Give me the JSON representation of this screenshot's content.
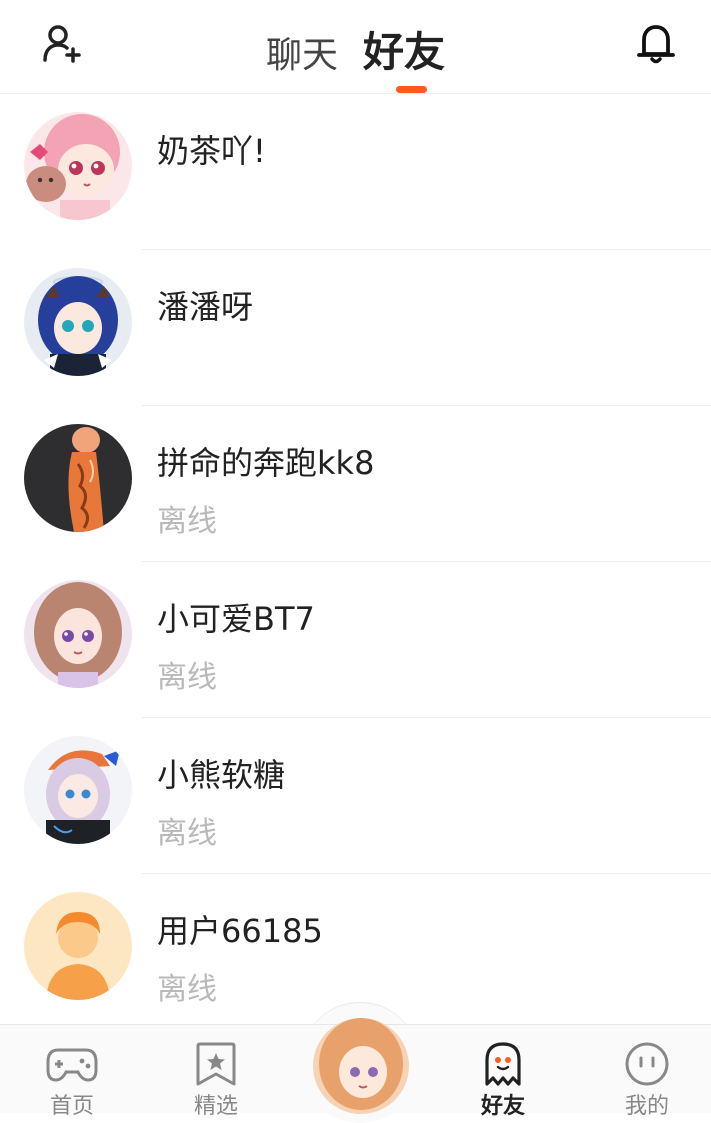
{
  "header": {
    "tabs": [
      {
        "label": "聊天",
        "active": false
      },
      {
        "label": "好友",
        "active": true
      }
    ],
    "accent_color": "#ff5a1f"
  },
  "friends": [
    {
      "name": "奶茶吖!",
      "status": "",
      "avatar": "pink-hair-anime-avatar"
    },
    {
      "name": "潘潘呀",
      "status": "",
      "avatar": "blue-hair-anime-avatar"
    },
    {
      "name": "拼命的奔跑kk8",
      "status": "离线",
      "avatar": "orange-figure-avatar"
    },
    {
      "name": "小可爱BT7",
      "status": "离线",
      "avatar": "brown-hair-girl-avatar"
    },
    {
      "name": "小熊软糖",
      "status": "离线",
      "avatar": "cap-girl-avatar"
    },
    {
      "name": "用户66185",
      "status": "离线",
      "avatar": "default-user-avatar"
    }
  ],
  "bottom_nav": {
    "items": [
      {
        "label": "首页",
        "icon": "gamepad-icon",
        "active": false
      },
      {
        "label": "精选",
        "icon": "star-bookmark-icon",
        "active": false
      },
      {
        "label": "",
        "icon": "center-avatar",
        "active": false
      },
      {
        "label": "好友",
        "icon": "ghost-icon",
        "active": true
      },
      {
        "label": "我的",
        "icon": "smiley-face-icon",
        "active": false
      }
    ]
  }
}
